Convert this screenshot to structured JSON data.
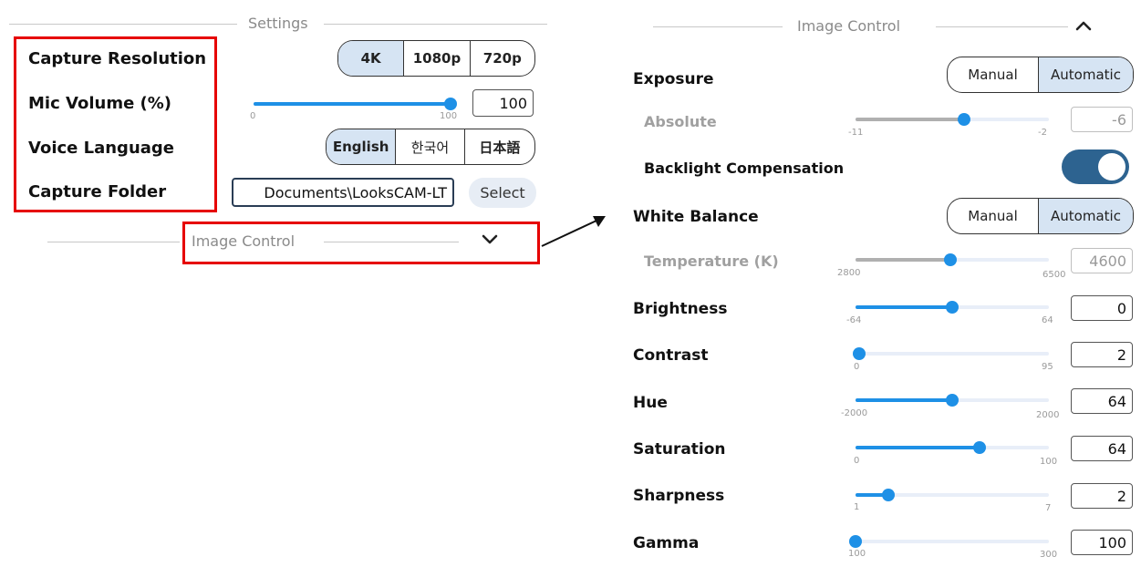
{
  "settings": {
    "section_title": "Settings",
    "capture_resolution": {
      "label": "Capture Resolution",
      "options": [
        "4K",
        "1080p",
        "720p"
      ],
      "selected": "4K"
    },
    "mic_volume": {
      "label": "Mic Volume (%)",
      "min": "0",
      "max": "100",
      "value": "100",
      "fraction": 1.0
    },
    "voice_language": {
      "label": "Voice Language",
      "options": [
        "English",
        "한국어",
        "日本語"
      ],
      "selected": "English"
    },
    "capture_folder": {
      "label": "Capture Folder",
      "value": "Documents\\LooksCAM-LT",
      "button": "Select"
    },
    "image_control_collapsed_title": "Image Control"
  },
  "image_control": {
    "section_title": "Image Control",
    "exposure": {
      "label": "Exposure",
      "options": [
        "Manual",
        "Automatic"
      ],
      "selected": "Automatic"
    },
    "absolute": {
      "label": "Absolute",
      "min": "-11",
      "max": "-2",
      "value": "-6",
      "fraction": 0.56
    },
    "backlight": {
      "label": "Backlight Compensation",
      "on": true
    },
    "white_balance": {
      "label": "White Balance",
      "options": [
        "Manual",
        "Automatic"
      ],
      "selected": "Automatic"
    },
    "temperature": {
      "label": "Temperature (K)",
      "min": "2800",
      "max": "6500",
      "value": "4600",
      "fraction": 0.49
    },
    "brightness": {
      "label": "Brightness",
      "min": "-64",
      "max": "64",
      "value": "0",
      "fraction": 0.5
    },
    "contrast": {
      "label": "Contrast",
      "min": "0",
      "max": "95",
      "value": "2",
      "fraction": 0.02
    },
    "hue": {
      "label": "Hue",
      "min": "-2000",
      "max": "2000",
      "value": "64",
      "fraction": 0.5
    },
    "saturation": {
      "label": "Saturation",
      "min": "0",
      "max": "100",
      "value": "64",
      "fraction": 0.64
    },
    "sharpness": {
      "label": "Sharpness",
      "min": "1",
      "max": "7",
      "value": "2",
      "fraction": 0.17
    },
    "gamma": {
      "label": "Gamma",
      "min": "100",
      "max": "300",
      "value": "100",
      "fraction": 0.0
    }
  },
  "colors": {
    "highlight_red": "#e60000",
    "accent_blue": "#1e90e6",
    "segment_active": "#d6e4f3",
    "toggle_on": "#2d6390"
  }
}
